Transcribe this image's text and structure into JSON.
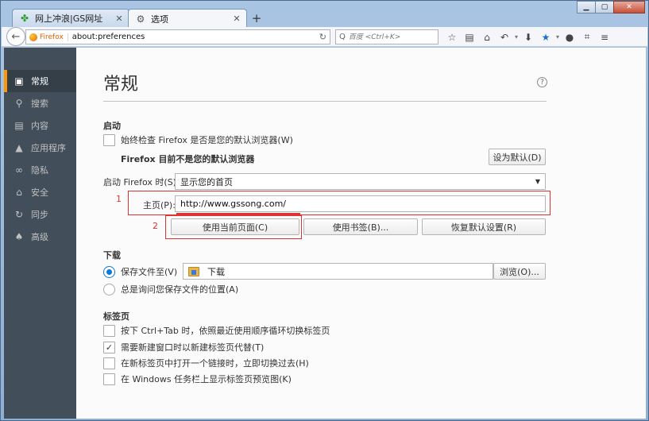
{
  "tabs": [
    {
      "label": "网上冲浪|GS网址",
      "icon": "gs-site-icon"
    },
    {
      "label": "选项",
      "icon": "gear-icon"
    }
  ],
  "navbar": {
    "identity_label": "Firefox",
    "url": "about:preferences",
    "search_placeholder": "百度 <Ctrl+K>",
    "search_engine_label": "Q"
  },
  "sidebar": {
    "items": [
      {
        "label": "常规",
        "icon": "general-icon"
      },
      {
        "label": "搜索",
        "icon": "search-icon"
      },
      {
        "label": "内容",
        "icon": "content-icon"
      },
      {
        "label": "应用程序",
        "icon": "applications-icon"
      },
      {
        "label": "隐私",
        "icon": "mask-icon"
      },
      {
        "label": "安全",
        "icon": "security-icon"
      },
      {
        "label": "同步",
        "icon": "sync-icon"
      },
      {
        "label": "高级",
        "icon": "advanced-icon"
      }
    ]
  },
  "main": {
    "title": "常规",
    "startup": {
      "heading": "启动",
      "always_check_label": "始终检查 Firefox 是否是您的默认浏览器(W)",
      "not_default_text": "Firefox 目前不是您的默认浏览器",
      "set_default_button": "设为默认(D)",
      "when_starts_label": "启动 Firefox 时(S):",
      "when_starts_value": "显示您的首页",
      "homepage_label": "主页(P):",
      "homepage_value": "http://www.gssong.com/",
      "use_current_button": "使用当前页面(C)",
      "use_bookmark_button": "使用书签(B)...",
      "restore_default_button": "恢复默认设置(R)"
    },
    "downloads": {
      "heading": "下载",
      "save_to_label": "保存文件至(V)",
      "save_to_value": "下载",
      "browse_button": "浏览(O)...",
      "always_ask_label": "总是询问您保存文件的位置(A)"
    },
    "tabs_section": {
      "heading": "标签页",
      "items": [
        {
          "label": "按下 Ctrl+Tab 时，依照最近使用顺序循环切换标签页",
          "checked": false
        },
        {
          "label": "需要新建窗口时以新建标签页代替(T)",
          "checked": true
        },
        {
          "label": "在新标签页中打开一个链接时，立即切换过去(H)",
          "checked": false
        },
        {
          "label": "在 Windows 任务栏上显示标签页预览图(K)",
          "checked": false
        }
      ]
    },
    "annotations": {
      "one": "1",
      "two": "2"
    }
  },
  "colors": {
    "sidebar_bg": "#424f5a",
    "sidebar_accent": "#ff9500",
    "annotation_red": "#dd3333",
    "radio_blue": "#0c78d6"
  }
}
